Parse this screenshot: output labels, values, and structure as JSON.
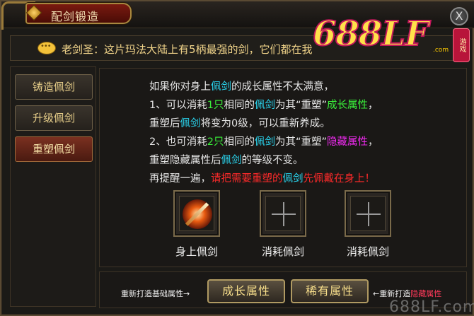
{
  "window": {
    "title": "配剑锻造",
    "close_label": "X"
  },
  "logo": {
    "text": "688LF",
    "sub": ".com",
    "seal": "游戏"
  },
  "npc": {
    "message": "老剑圣：这片玛法大陆上有5柄最强的剑，它们都在我"
  },
  "sidebar": {
    "items": [
      {
        "label": "铸造佩剑",
        "active": false
      },
      {
        "label": "升级佩剑",
        "active": false
      },
      {
        "label": "重塑佩剑",
        "active": true
      }
    ]
  },
  "info": {
    "line1": {
      "a": "如果你对身上",
      "b": "佩剑",
      "c": "的成长属性不太满意，"
    },
    "line2": {
      "a": "1、可以消耗",
      "b": "1只",
      "c": "相同的",
      "d": "佩剑",
      "e": "为其“重塑”",
      "f": "成长属性",
      "g": "，"
    },
    "line3": {
      "a": "重塑后",
      "b": "佩剑",
      "c": "将变为0级，可以重新养成。"
    },
    "line4": {
      "a": "2、也可消耗",
      "b": "2只",
      "c": "相同的",
      "d": "佩剑",
      "e": "为其“重塑”",
      "f": "隐藏属性",
      "g": "，"
    },
    "line5": {
      "a": "重塑隐藏属性后",
      "b": "佩剑",
      "c": "的等级不变。"
    },
    "line6": {
      "a": "再提醒一遍，",
      "b": "请把需要重塑的",
      "c": "佩剑",
      "d": "先佩戴在身上！"
    }
  },
  "slots": [
    {
      "label": "身上佩剑",
      "content": "sword-icon"
    },
    {
      "label": "消耗佩剑",
      "content": "plus-icon"
    },
    {
      "label": "消耗佩剑",
      "content": "plus-icon"
    }
  ],
  "bottom": {
    "hint_left": "重新打造基础属性→",
    "btn_growth": "成长属性",
    "btn_rare": "稀有属性",
    "hint_right_a": "←重新打造",
    "hint_right_b": "隐藏属性"
  },
  "watermark": "688LF.com",
  "colors": {
    "cyan": "#2ad6f0",
    "green": "#3af03a",
    "purple": "#f02af0",
    "red": "#ff2a2a",
    "gold_text": "#f1d48a"
  }
}
